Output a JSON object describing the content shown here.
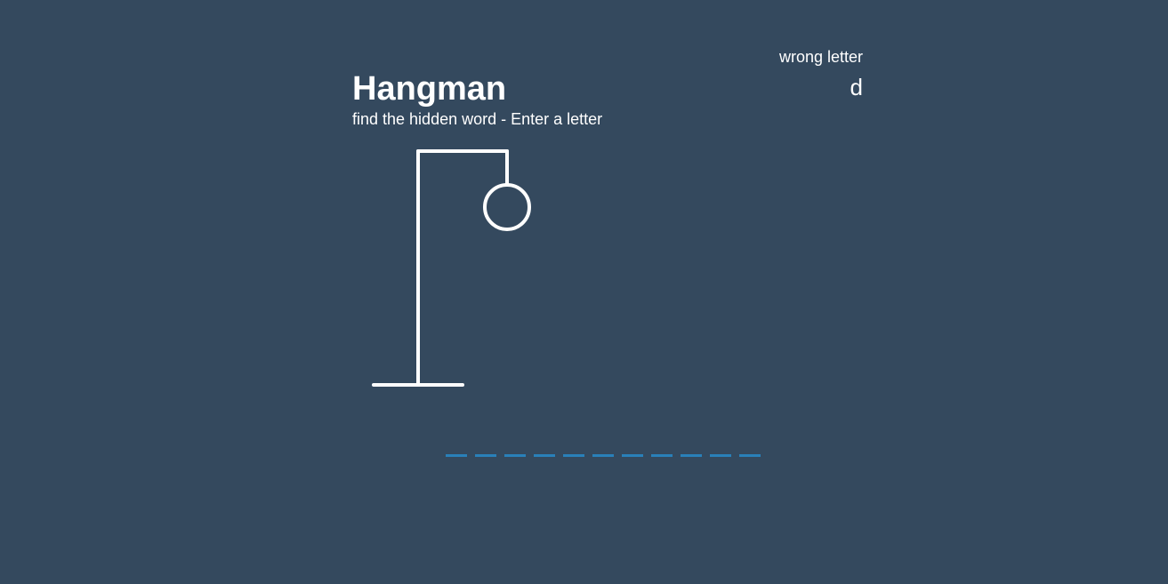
{
  "header": {
    "title": "Hangman",
    "subtitle": "find the hidden word - Enter a letter"
  },
  "wrong": {
    "label": "wrong letter",
    "letters": "d"
  },
  "figure": {
    "wrong_count": 1,
    "parts_shown": [
      "head"
    ]
  },
  "word": {
    "length": 11,
    "revealed": [
      "",
      "",
      "",
      "",
      "",
      "",
      "",
      "",
      "",
      "",
      ""
    ]
  },
  "colors": {
    "background": "#34495e",
    "foreground": "#ffffff",
    "blank": "#2980b9"
  }
}
